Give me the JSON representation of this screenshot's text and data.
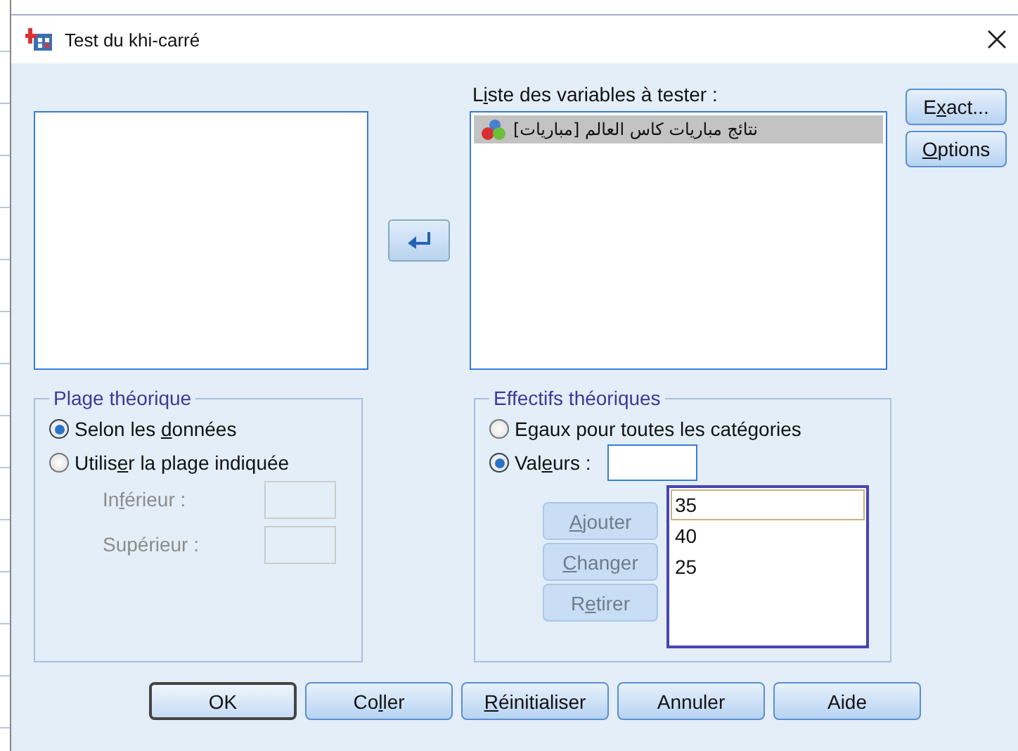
{
  "window": {
    "title": "Test du khi-carré"
  },
  "test_list": {
    "label": {
      "pre": "L",
      "key": "i",
      "post": "ste des variables à tester :"
    },
    "items": [
      {
        "label": "نتائج مباريات كاس العالم [مباريات]",
        "selected": true
      }
    ]
  },
  "side_buttons": [
    {
      "label": {
        "pre": "E",
        "key": "x",
        "post": "act..."
      }
    },
    {
      "label": {
        "key": "O",
        "post": "ptions"
      }
    }
  ],
  "range_group": {
    "title": "Plage théorique",
    "options": [
      {
        "label": {
          "pre": "Selon les ",
          "key": "d",
          "post": "onnées"
        },
        "selected": true
      },
      {
        "label": {
          "pre": "Utilis",
          "key": "e",
          "post": "r la plage indiquée"
        },
        "selected": false
      }
    ],
    "fields": [
      {
        "label": {
          "pre": "In",
          "key": "f",
          "post": "érieur :"
        },
        "disabled": true
      },
      {
        "label": "Supérieur :",
        "disabled": true
      }
    ]
  },
  "expected_group": {
    "title": "Effectifs théoriques",
    "options": [
      {
        "label": "Egaux pour toutes les catégories",
        "selected": false
      },
      {
        "label": {
          "pre": "Val",
          "key": "e",
          "post": "urs :"
        },
        "selected": true
      }
    ],
    "buttons": [
      {
        "label": {
          "key": "A",
          "post": "jouter"
        },
        "disabled": true
      },
      {
        "label": {
          "key": "C",
          "post": "hanger"
        },
        "disabled": true
      },
      {
        "label": {
          "pre": "R",
          "key": "e",
          "post": "tirer"
        },
        "disabled": true
      }
    ],
    "values": [
      {
        "label": "35",
        "selected": true
      },
      {
        "label": "40",
        "selected": false
      },
      {
        "label": "25",
        "selected": false
      }
    ]
  },
  "buttons": [
    {
      "label": "OK",
      "default": true
    },
    {
      "label": {
        "pre": "Co",
        "key": "l",
        "post": "ler"
      },
      "default": false
    },
    {
      "label": {
        "key": "R",
        "post": "éinitialiser"
      },
      "default": false
    },
    {
      "label": "Annuler",
      "default": false
    },
    {
      "label": "Aide",
      "default": false
    }
  ]
}
